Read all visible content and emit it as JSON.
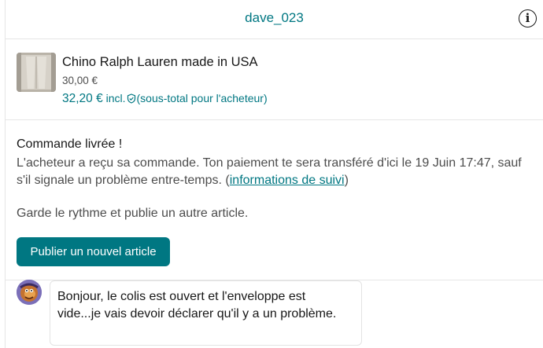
{
  "header": {
    "username": "dave_023",
    "info_icon": "info-icon"
  },
  "item": {
    "title": "Chino Ralph Lauren made in USA",
    "price": "30,00 €",
    "total_price": "32,20 €",
    "total_suffix": "incl.",
    "total_note": "(sous-total pour l'acheteur)",
    "thumb_icon": "product-thumbnail"
  },
  "status": {
    "title": "Commande livrée !",
    "body_text": "L'acheteur a reçu sa commande. Ton paiement te sera transféré d'ici le 19 Juin 17:47, sauf s'il signale un problème entre-temps. (",
    "tracking_link": "informations de suivi",
    "body_end": ")",
    "cta_text": "Garde le rythme et publie un autre article.",
    "button_label": "Publier un nouvel article"
  },
  "message": {
    "text": "Bonjour, le colis est ouvert et l'enveloppe est vide...je vais devoir déclarer qu'il y a un problème."
  },
  "colors": {
    "accent": "#007782",
    "text": "#171717",
    "muted": "#4d4d4d",
    "border": "#e6e6e6"
  }
}
